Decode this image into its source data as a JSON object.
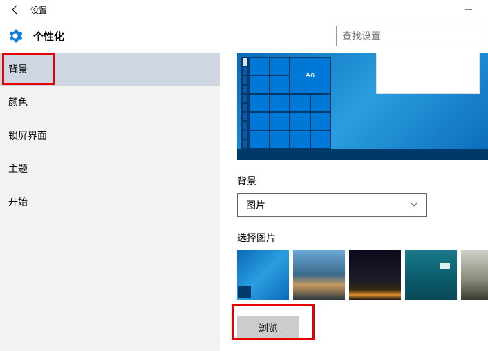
{
  "titlebar": {
    "title": "设置"
  },
  "header": {
    "title": "个性化",
    "search_placeholder": "查找设置"
  },
  "sidebar": {
    "items": [
      {
        "label": "背景",
        "active": true
      },
      {
        "label": "颜色"
      },
      {
        "label": "锁屏界面"
      },
      {
        "label": "主题"
      },
      {
        "label": "开始"
      }
    ]
  },
  "preview": {
    "tile_text": "Aa"
  },
  "content": {
    "background_label": "背景",
    "dropdown_value": "图片",
    "choose_picture_label": "选择图片",
    "browse_label": "浏览"
  }
}
